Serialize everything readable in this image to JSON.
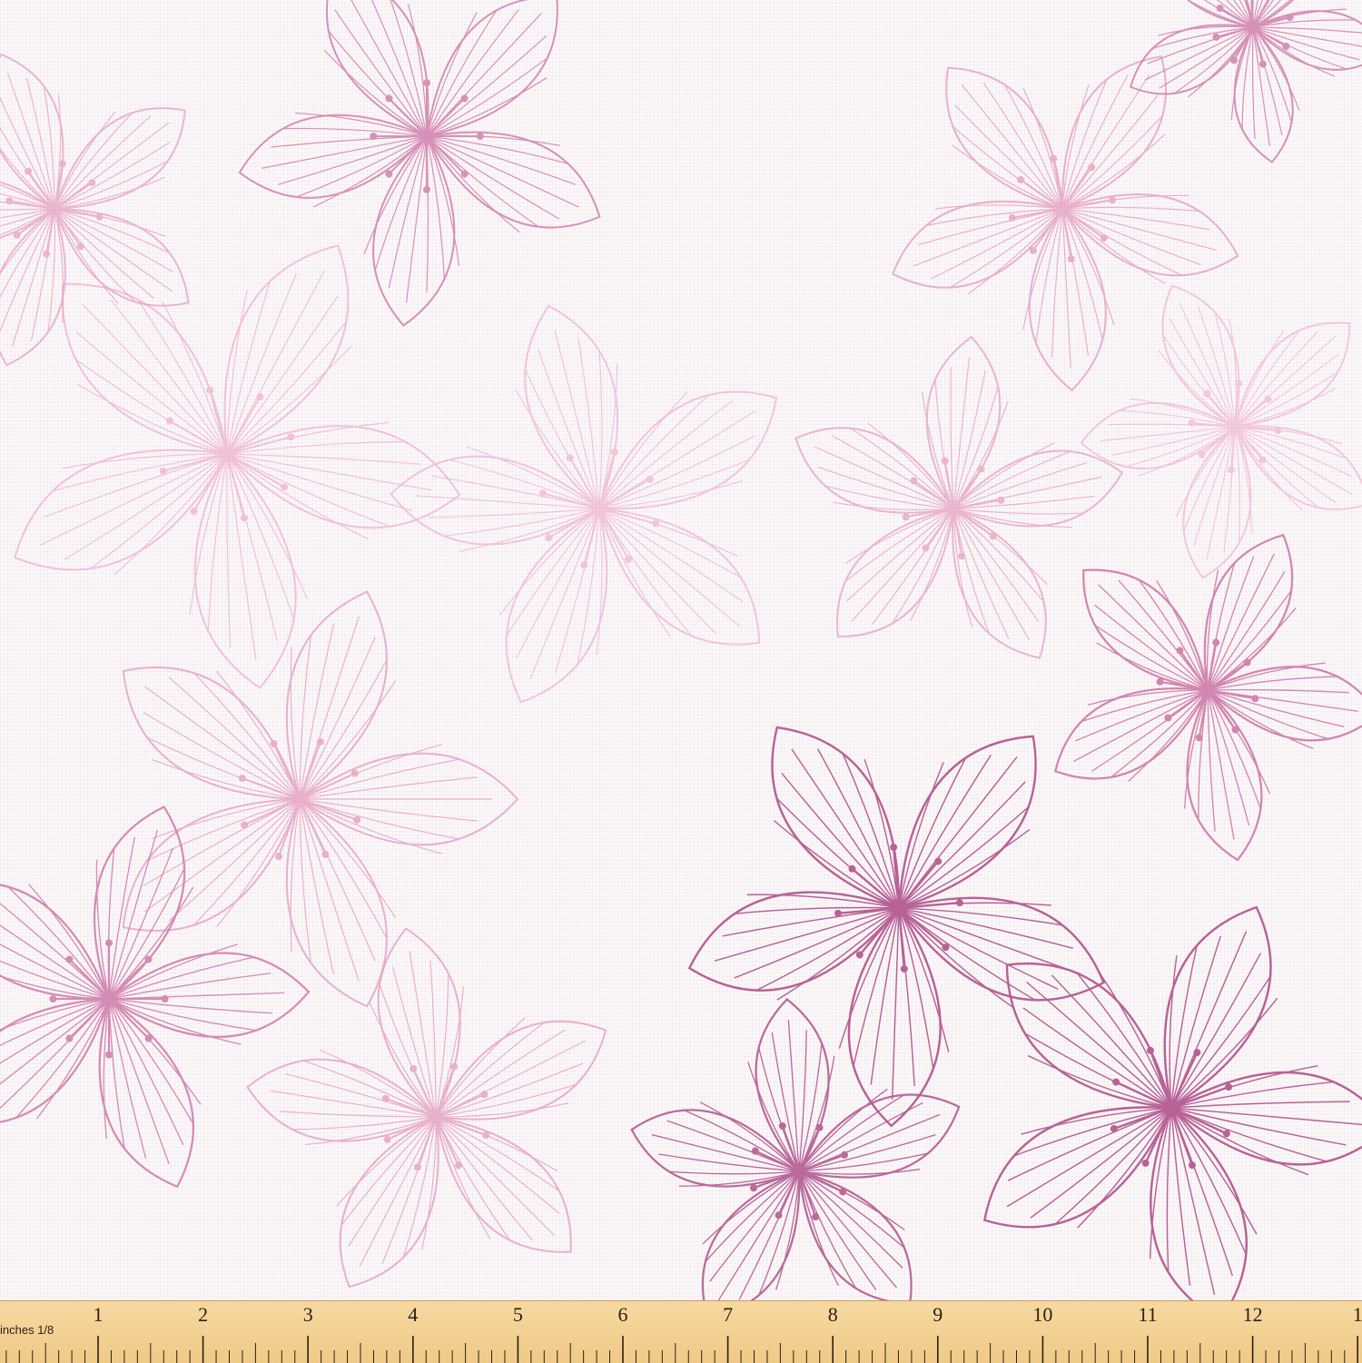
{
  "image": {
    "subject": "pink floral line-art fabric",
    "colors": {
      "background": "#fcf8fa",
      "pale_pink": "#f3bcd6",
      "light_pink": "#e8a3c4",
      "mauve": "#d07bab",
      "dark_mauve": "#b65b93",
      "ruler": "#f3cf91"
    }
  },
  "ruler": {
    "unit_label": "inches 1/8",
    "numbers": [
      "1",
      "2",
      "3",
      "4",
      "5",
      "6",
      "7",
      "8",
      "9",
      "10",
      "11",
      "12",
      "1"
    ]
  }
}
